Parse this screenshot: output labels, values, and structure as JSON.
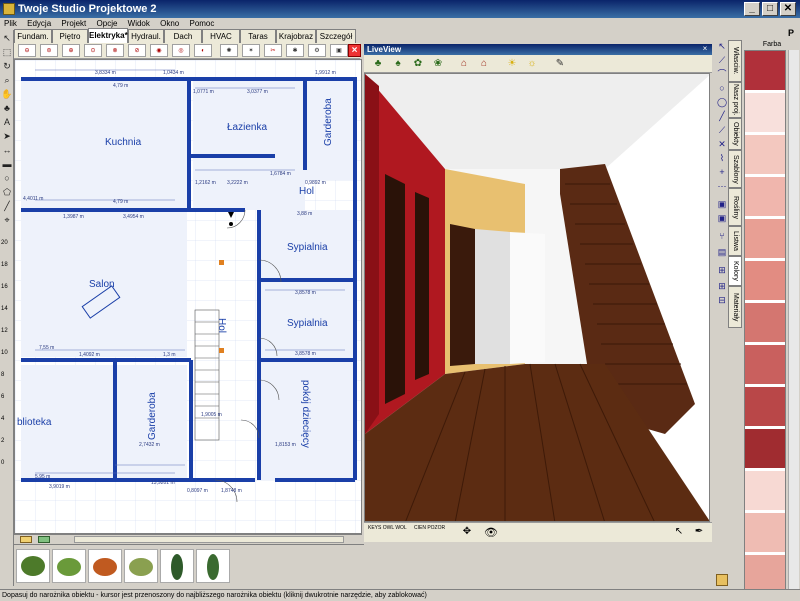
{
  "window": {
    "title": "Twoje Studio Projektowe 2",
    "minimize_glyph": "_",
    "maximize_glyph": "□",
    "close_glyph": "✕"
  },
  "menu": [
    "Plik",
    "Edycja",
    "Projekt",
    "Opcje",
    "Widok",
    "Okno",
    "Pomoc"
  ],
  "tabs": [
    {
      "label": "Fundam."
    },
    {
      "label": "Piętro"
    },
    {
      "label": "Elektryka*"
    },
    {
      "label": "Hydraul."
    },
    {
      "label": "Dach"
    },
    {
      "label": "HVAC"
    },
    {
      "label": "Taras"
    },
    {
      "label": "Krajobraz"
    },
    {
      "label": "Szczegół"
    }
  ],
  "active_tab": "Elektryka*",
  "plan": {
    "rooms": [
      "Kuchnia",
      "Łazienka",
      "Garderoba",
      "Hol",
      "Salon",
      "Sypialnia",
      "Sypialnia",
      "Hol",
      "Garderoba",
      "pokój dziecięcy",
      "blioteka"
    ],
    "dimensions": [
      "3,8334 m",
      "1,0434 m",
      "1,9912 m",
      "4,79 m",
      "1,0771 m",
      "3,0377 m",
      "1,6784 m",
      "1,2162 m",
      "3,2222 m",
      "0,9892 m",
      "3,4954 m",
      "4,79 m",
      "1,3987 m",
      "4,4011 m",
      "3,88 m",
      "3,8578 m",
      "3,8578 m",
      "7,55 m",
      "1,4092 m",
      "1,3 m",
      "1,9005 m",
      "2,7432 m",
      "5,95 m",
      "3,9019 m",
      "13,9201 m",
      "0,8097 m",
      "1,8748 m",
      "1,8153 m"
    ]
  },
  "left_ruler": [
    "20",
    "18",
    "16",
    "14",
    "12",
    "10",
    "8",
    "6",
    "4",
    "2",
    "0"
  ],
  "liveview": {
    "title": "LiveView",
    "close_glyph": "×",
    "bottom_label_1": "KEYS   OWL\nWOL",
    "bottom_label_2": "CIEN   POZOR"
  },
  "right_panel": {
    "vtabs": [
      "Własciw.",
      "Nasz proj.",
      "Obiekty",
      "Szablony",
      "Rośliny",
      "Listwa",
      "Kolory",
      "Materiały"
    ],
    "active_vtab": "Kolory",
    "swatch_label": "Farba",
    "swatches": [
      "#b0303a",
      "#f8e0dc",
      "#f3c8bf",
      "#f0b6ad",
      "#e89f94",
      "#e28c82",
      "#d47670",
      "#c9605e",
      "#b94748",
      "#a02c30",
      "#f7d9d3",
      "#efbcb3",
      "#e7a59b",
      "#dd8a82",
      "#cf6f6b"
    ]
  },
  "status_text": "Dopasuj do narożnika obiektu - kursor jest przenoszony do najbliższego narożnika obiektu (kliknij dwukrotnie narzędzie, aby zablokować)",
  "colors": {
    "wall": "#1a3fa8",
    "titlebar": "#0a246a",
    "accent_red": "#b0303a"
  }
}
